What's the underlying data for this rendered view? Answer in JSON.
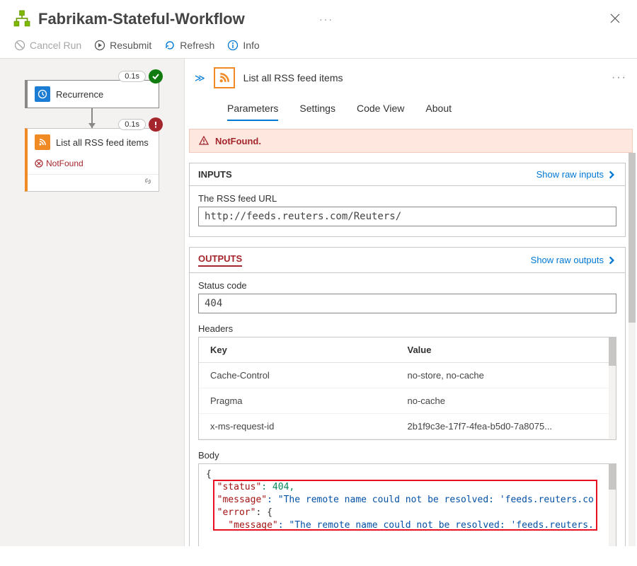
{
  "header": {
    "title": "Fabrikam-Stateful-Workflow",
    "more": "···"
  },
  "toolbar": {
    "cancel": "Cancel Run",
    "resubmit": "Resubmit",
    "refresh": "Refresh",
    "info": "Info"
  },
  "designer": {
    "recurrence": {
      "label": "Recurrence",
      "time": "0.1s"
    },
    "rss": {
      "label": "List all RSS feed items",
      "time": "0.1s",
      "error": "NotFound"
    }
  },
  "details": {
    "title": "List all RSS feed items",
    "more": "···",
    "collapse": "≫",
    "tabs": [
      "Parameters",
      "Settings",
      "Code View",
      "About"
    ],
    "alert": "NotFound.",
    "inputs": {
      "title": "INPUTS",
      "link": "Show raw inputs",
      "feed_label": "The RSS feed URL",
      "feed_value": "http://feeds.reuters.com/Reuters/"
    },
    "outputs": {
      "title": "OUTPUTS",
      "link": "Show raw outputs",
      "status_label": "Status code",
      "status_value": "404",
      "headers_label": "Headers",
      "headers_key": "Key",
      "headers_val": "Value",
      "headers": [
        {
          "k": "Cache-Control",
          "v": "no-store, no-cache"
        },
        {
          "k": "Pragma",
          "v": "no-cache"
        },
        {
          "k": "x-ms-request-id",
          "v": "2b1f9c3e-17f7-4fea-b5d0-7a8075..."
        }
      ],
      "body_label": "Body",
      "body_json": {
        "line1": "{",
        "line2_k": "  \"status\"",
        "line2_v": ": 404,",
        "line3_k": "  \"message\"",
        "line3_v": ": \"The remote name could not be resolved: 'feeds.reuters.co",
        "line4_k": "  \"error\"",
        "line4_v": ": {",
        "line5_k": "    \"message\"",
        "line5_v": ": \"The remote name could not be resolved: 'feeds.reuters."
      }
    }
  }
}
